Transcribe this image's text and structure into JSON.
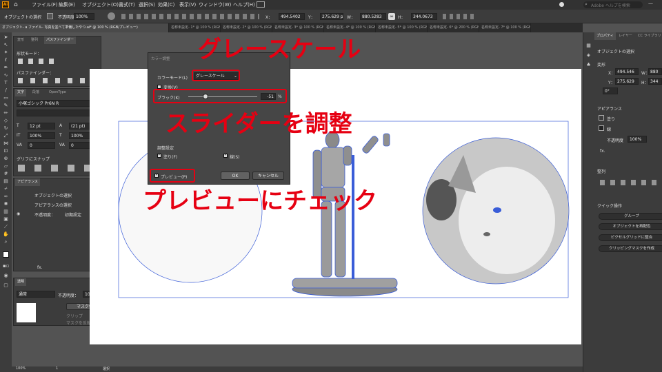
{
  "menubar": {
    "items": [
      "ファイル(F)",
      "編集(E)",
      "オブジェクト(O)",
      "書式(T)",
      "選択(S)",
      "効果(C)",
      "表示(V)",
      "ウィンドウ(W)",
      "ヘルプ(H)"
    ],
    "search_placeholder": "Adobe ヘルプを検索"
  },
  "controlbar": {
    "object_label": "オブジェクトの選択",
    "opacity_label": "不透明度：",
    "opacity_value": "100%",
    "x_label": "X：",
    "x_value": "494.5402",
    "y_label": "Y：",
    "y_value": "275.629 px",
    "w_label": "W：",
    "w_value": "880.5283",
    "h_label": "H：",
    "h_value": "344.0673"
  },
  "tabs": [
    "オブジェクト- a ファイル- 写真を並べて準備したやつ.ai* @ 100 % (RGB/プレビュー)",
    "名称未設定- 1* @ 100 % (RGB/プレ…",
    "名称未設定- 2* @ 100 % (RGB/プレ…",
    "名称未設定- 3* @ 100 % (RGB/プレ…",
    "名称未設定- 4* @ 100 % (RGB/プレ…",
    "名称未設定- 5* @ 100 % (RGB/プレ…",
    "名称未設定- 6* @ 200 % (RGB/プレ…",
    "名称未設定- 7* @ 100 % (RGB/プレ…"
  ],
  "pathfinder_panel": {
    "tabs": [
      "変形",
      "整列",
      "パスファインダー"
    ],
    "shape_mode_label": "形状モード：",
    "pathfinder_label": "パスファインダー："
  },
  "character_panel": {
    "tabs": [
      "文字",
      "段落",
      "OpenType"
    ],
    "font_family": "小塚ゴシック Pr6N R",
    "font_size": "12 pt",
    "leading": "(21 pt)",
    "vertical_scale": "100%",
    "horizontal_scale": "100%",
    "kerning": "0",
    "tracking": "0",
    "glyph_snap_label": "グリフにスナップ"
  },
  "appearance_left": {
    "tab": "アピアランス",
    "rows": [
      "オブジェクトの選択",
      "アピアランスの選択",
      "不透明度：",
      "初期設定"
    ]
  },
  "transparency_panel": {
    "tab": "透明",
    "blend_mode": "通常",
    "opacity_label": "不透明度：",
    "opacity_value": "100%",
    "mask_button": "マスク作成",
    "clip_label": "クリップ",
    "invert_mask_label": "マスクを反転"
  },
  "dialog": {
    "title": "カラー調整",
    "color_mode_label": "カラーモード(L)",
    "color_mode_value": "グレースケール",
    "convert_label": "変換(V)",
    "black_label": "ブラック(K)",
    "black_value": "-51",
    "black_unit": "%",
    "black_fraction": 0.245,
    "adjust_settings_label": "調整設定",
    "fill_label": "塗り(F)",
    "stroke_label": "線(S)",
    "preview_label": "プレビュー(P)",
    "ok_label": "OK",
    "cancel_label": "キャンセル"
  },
  "callouts": {
    "grayscale": "グレースケール",
    "adjust_slider": "スライダーを調整",
    "check_preview": "プレビューにチェック"
  },
  "right_panel": {
    "tabs": [
      "プロパティ",
      "レイヤー",
      "CC ライブラリ"
    ],
    "selection_label": "オブジェクトの選択",
    "transform_header": "変形",
    "x_label": "X：",
    "x_value": "494.546",
    "w_label": "W：",
    "w_value": "880",
    "y_label": "Y：",
    "y_value": "275.629",
    "h_label": "H：",
    "h_value": "344",
    "angle_value": "0°",
    "appearance_header": "アピアランス",
    "fill_label": "塗り",
    "stroke_label": "線",
    "opacity_label": "不透明度",
    "opacity_value": "100%",
    "fx_label": "fx.",
    "align_header": "整列",
    "quick_actions_header": "クイック操作",
    "quick_actions": [
      "グループ",
      "オブジェクトを再配色",
      "ピクセルグリッドに整合",
      "クリッピングマスクを作成"
    ]
  },
  "status": {
    "zoom": "100%",
    "artboard": "1",
    "tool_name": "選択"
  },
  "colors": {
    "callout_red": "#e60012",
    "selection_blue": "#3a5dd8",
    "app_bg": "#535353",
    "panel_bg": "#3c3c3c"
  },
  "icons": [
    "home-icon",
    "search-icon",
    "selection-tool-icon",
    "pen-tool-icon",
    "type-tool-icon",
    "rectangle-tool-icon",
    "zoom-tool-icon",
    "hand-tool-icon",
    "link-icon"
  ]
}
